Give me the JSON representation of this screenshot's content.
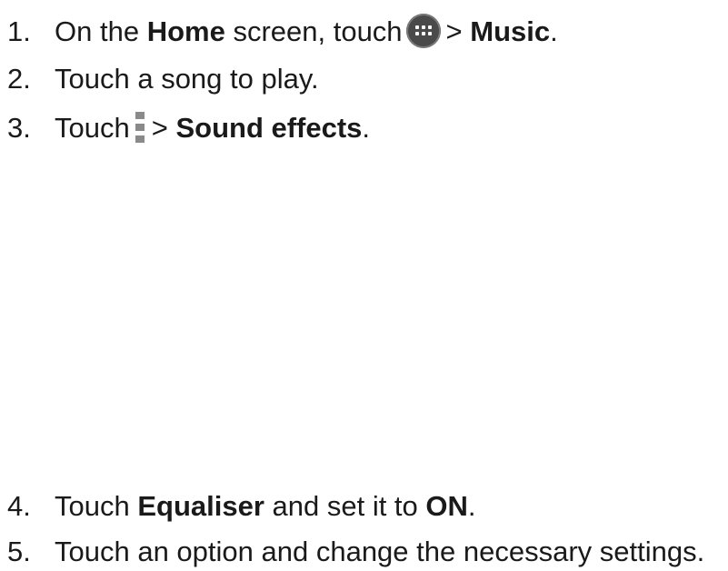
{
  "steps": [
    {
      "number": "1.",
      "text_a": "On the ",
      "bold_a": "Home",
      "text_b": " screen, touch",
      "icon": "apps-launcher-icon",
      "text_c": "> ",
      "bold_b": "Music",
      "text_d": "."
    },
    {
      "number": "2.",
      "text": "Touch a song to play."
    },
    {
      "number": "3.",
      "text_a": "Touch",
      "icon": "overflow-menu-icon",
      "text_b": "> ",
      "bold_a": "Sound effects",
      "text_c": "."
    },
    {
      "number": "4.",
      "text_a": "Touch ",
      "bold_a": "Equaliser",
      "text_b": " and set it to ",
      "bold_b": "ON",
      "text_c": "."
    },
    {
      "number": "5.",
      "text": "Touch an option and change the necessary settings."
    }
  ],
  "colors": {
    "text": "#1a1a1a",
    "apps_icon_bg": "#4a4a4a",
    "menu_icon": "#8a8a8a"
  }
}
